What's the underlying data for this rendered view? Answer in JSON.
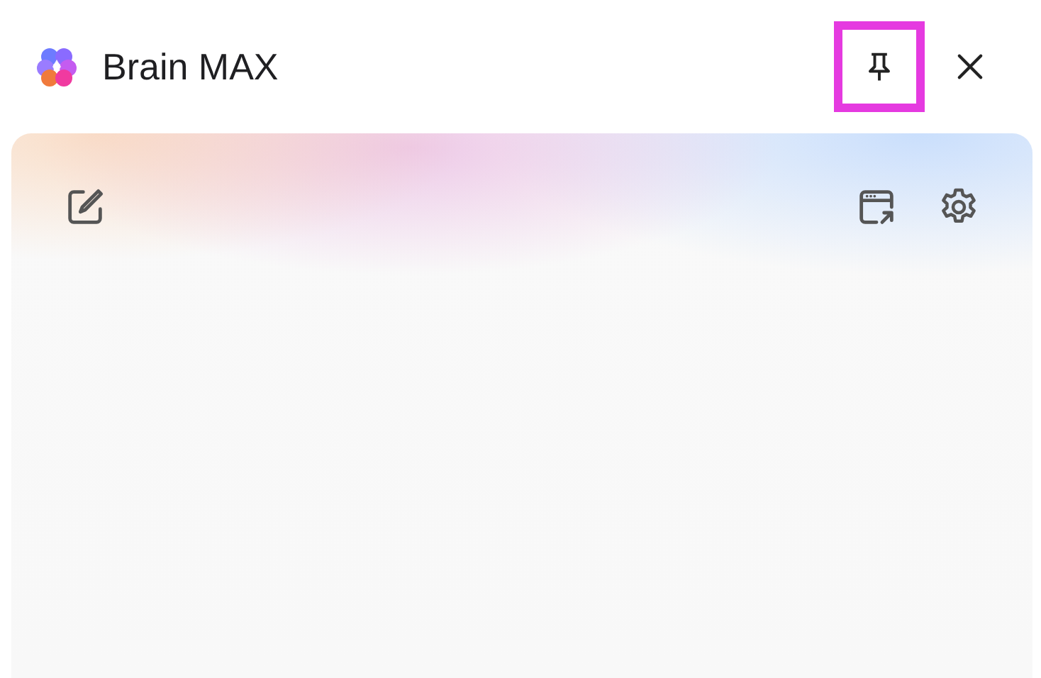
{
  "window": {
    "title": "Brain MAX"
  },
  "header_buttons": [
    {
      "kind": "pin",
      "highlighted": true
    },
    {
      "kind": "close",
      "highlighted": false
    }
  ],
  "toolbar": {
    "left": [
      {
        "kind": "compose"
      }
    ],
    "right": [
      {
        "kind": "open-window"
      },
      {
        "kind": "settings"
      }
    ]
  }
}
